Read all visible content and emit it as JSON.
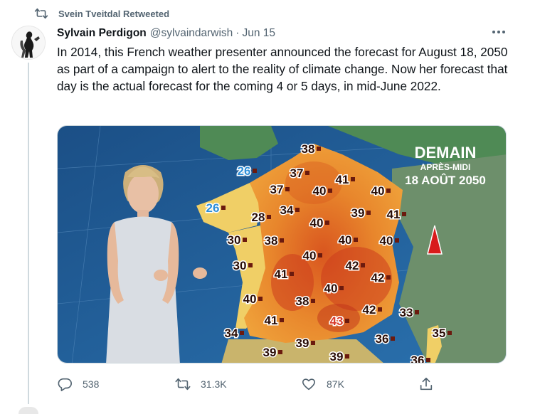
{
  "retweet": {
    "icon": "retweet-icon",
    "text": "Svein Tveitdal Retweeted"
  },
  "tweet": {
    "author_name": "Sylvain Perdigon",
    "handle": "@sylvaindarwish",
    "separator": "·",
    "date": "Jun 15",
    "text": "In 2014, this French weather presenter announced the forecast for August 18, 2050 as part of a campaign to alert to the reality of climate change. Now her forecast that day is the actual forecast for the coming 4 or 5 days, in mid-June 2022."
  },
  "media": {
    "title_line1": "DEMAIN",
    "title_line2": "APRÈS-MIDI",
    "title_line3": "18 AOÛT 2050",
    "temperatures": [
      "38",
      "26",
      "37",
      "41",
      "37",
      "40",
      "40",
      "26",
      "28",
      "34",
      "39",
      "41",
      "30",
      "38",
      "40",
      "40",
      "40",
      "40",
      "30",
      "41",
      "42",
      "42",
      "40",
      "40",
      "38",
      "41",
      "43",
      "42",
      "33",
      "34",
      "39",
      "36",
      "35",
      "39",
      "39",
      "36"
    ],
    "colors": {
      "sea": "#1f5f97",
      "heat_orange": "#e8862c",
      "heat_red": "#cc3d1d",
      "cool_yellow": "#f0cf66"
    }
  },
  "actions": {
    "reply": {
      "icon": "reply-icon",
      "count": "538"
    },
    "retweet": {
      "icon": "retweet-icon",
      "count": "31.3K"
    },
    "like": {
      "icon": "heart-icon",
      "count": "87K"
    },
    "share": {
      "icon": "share-icon"
    }
  }
}
